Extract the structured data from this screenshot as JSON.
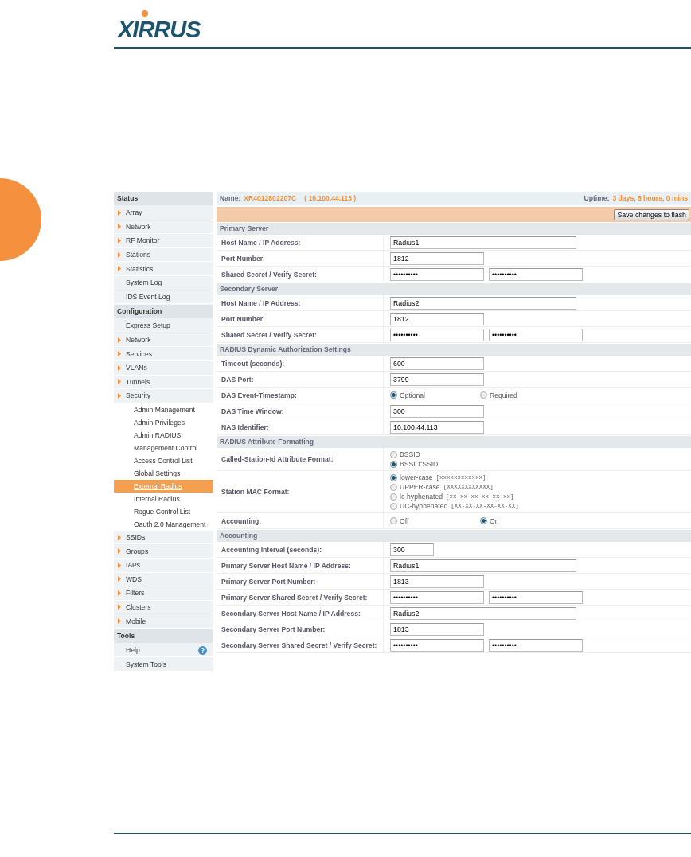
{
  "logo": {
    "text": "XIRRUS"
  },
  "sidebar": [
    {
      "title": "Status",
      "items": [
        {
          "label": "Array",
          "submenu": true,
          "selected": false
        },
        {
          "label": "Network",
          "submenu": true,
          "selected": false
        },
        {
          "label": "RF Monitor",
          "submenu": true,
          "selected": false
        },
        {
          "label": "Stations",
          "submenu": true,
          "selected": false
        },
        {
          "label": "Statistics",
          "submenu": true,
          "selected": false
        },
        {
          "label": "System Log",
          "submenu": false,
          "selected": false
        },
        {
          "label": "IDS Event Log",
          "submenu": false,
          "selected": false
        }
      ]
    },
    {
      "title": "Configuration",
      "items": [
        {
          "label": "Express Setup",
          "submenu": false,
          "selected": false
        },
        {
          "label": "Network",
          "submenu": true,
          "selected": false
        },
        {
          "label": "Services",
          "submenu": true,
          "selected": false
        },
        {
          "label": "VLANs",
          "submenu": true,
          "selected": false
        },
        {
          "label": "Tunnels",
          "submenu": true,
          "selected": false
        },
        {
          "label": "Security",
          "submenu": true,
          "selected": false,
          "children": [
            {
              "label": "Admin Management",
              "selected": false
            },
            {
              "label": "Admin Privileges",
              "selected": false
            },
            {
              "label": "Admin RADIUS",
              "selected": false
            },
            {
              "label": "Management Control",
              "selected": false
            },
            {
              "label": "Access Control List",
              "selected": false
            },
            {
              "label": "Global Settings",
              "selected": false
            },
            {
              "label": "External Radius",
              "selected": true
            },
            {
              "label": "Internal Radius",
              "selected": false
            },
            {
              "label": "Rogue Control List",
              "selected": false
            },
            {
              "label": "Oauth 2.0 Management",
              "selected": false
            }
          ]
        },
        {
          "label": "SSIDs",
          "submenu": true,
          "selected": false
        },
        {
          "label": "Groups",
          "submenu": true,
          "selected": false
        },
        {
          "label": "IAPs",
          "submenu": true,
          "selected": false
        },
        {
          "label": "WDS",
          "submenu": true,
          "selected": false
        },
        {
          "label": "Filters",
          "submenu": true,
          "selected": false
        },
        {
          "label": "Clusters",
          "submenu": true,
          "selected": false
        },
        {
          "label": "Mobile",
          "submenu": true,
          "selected": false
        }
      ]
    },
    {
      "title": "Tools",
      "items": [
        {
          "label": "Help",
          "submenu": false,
          "selected": false,
          "help": true
        },
        {
          "label": "System Tools",
          "submenu": false,
          "selected": false
        }
      ]
    }
  ],
  "header": {
    "name_label": "Name:",
    "name_value": "XR4012802207C",
    "ip": "( 10.100.44.113 )",
    "uptime_label": "Uptime:",
    "uptime_value": "3 days, 5 hours, 0 mins"
  },
  "save_button": "Save changes to flash",
  "sections": [
    {
      "title": "Primary Server",
      "rows": [
        {
          "label": "Host Name / IP Address:",
          "kind": "long",
          "value": "Radius1"
        },
        {
          "label": "Port Number:",
          "kind": "text",
          "value": "1812"
        },
        {
          "label": "Shared Secret / Verify Secret:",
          "kind": "pair",
          "value": "••••••••••",
          "value2": "••••••••••"
        }
      ]
    },
    {
      "title": "Secondary Server",
      "rows": [
        {
          "label": "Host Name / IP Address:",
          "kind": "long",
          "value": "Radius2"
        },
        {
          "label": "Port Number:",
          "kind": "text",
          "value": "1812"
        },
        {
          "label": "Shared Secret / Verify Secret:",
          "kind": "pair",
          "value": "••••••••••",
          "value2": "••••••••••"
        }
      ]
    },
    {
      "title": "RADIUS Dynamic Authorization Settings",
      "rows": [
        {
          "label": "Timeout (seconds):",
          "kind": "text",
          "value": "600"
        },
        {
          "label": "DAS Port:",
          "kind": "text",
          "value": "3799"
        },
        {
          "label": "DAS Event-Timestamp:",
          "kind": "inline",
          "options": [
            {
              "label": "Optional",
              "selected": true
            },
            {
              "label": "Required",
              "selected": false
            }
          ]
        },
        {
          "label": "DAS Time Window:",
          "kind": "text",
          "value": "300"
        },
        {
          "label": "NAS Identifier:",
          "kind": "text",
          "value": "10.100.44.113"
        }
      ]
    },
    {
      "title": "RADIUS Attribute Formatting",
      "rows": [
        {
          "label": "Called-Station-Id Attribute Format:",
          "kind": "stack",
          "options": [
            {
              "label": "BSSID",
              "selected": false
            },
            {
              "label": "BSSID:SSID",
              "selected": true
            }
          ]
        },
        {
          "label": "Station MAC Format:",
          "kind": "stack",
          "options": [
            {
              "label": "lower-case",
              "hint": "[xxxxxxxxxxxx]",
              "selected": true
            },
            {
              "label": "UPPER-case",
              "hint": "[XXXXXXXXXXXX]",
              "selected": false
            },
            {
              "label": "lc-hyphenated",
              "hint": "[xx-xx-xx-xx-xx-xx]",
              "selected": false
            },
            {
              "label": "UC-hyphenated",
              "hint": "[XX-XX-XX-XX-XX-XX]",
              "selected": false
            }
          ]
        },
        {
          "label": "Accounting:",
          "kind": "inline",
          "options": [
            {
              "label": "Off",
              "selected": false
            },
            {
              "label": "On",
              "selected": true
            }
          ]
        }
      ]
    },
    {
      "title": "Accounting",
      "rows": [
        {
          "label": "Accounting Interval (seconds):",
          "kind": "short",
          "value": "300"
        },
        {
          "label": "Primary Server Host Name / IP Address:",
          "kind": "long",
          "value": "Radius1"
        },
        {
          "label": "Primary Server Port Number:",
          "kind": "text",
          "value": "1813"
        },
        {
          "label": "Primary Server Shared Secret / Verify Secret:",
          "kind": "pair",
          "value": "••••••••••",
          "value2": "••••••••••"
        },
        {
          "label": "Secondary Server Host Name / IP Address:",
          "kind": "long",
          "value": "Radius2"
        },
        {
          "label": "Secondary Server Port Number:",
          "kind": "text",
          "value": "1813"
        },
        {
          "label": "Secondary Server Shared Secret / Verify Secret:",
          "kind": "pair",
          "value": "••••••••••",
          "value2": "••••••••••"
        }
      ]
    }
  ]
}
